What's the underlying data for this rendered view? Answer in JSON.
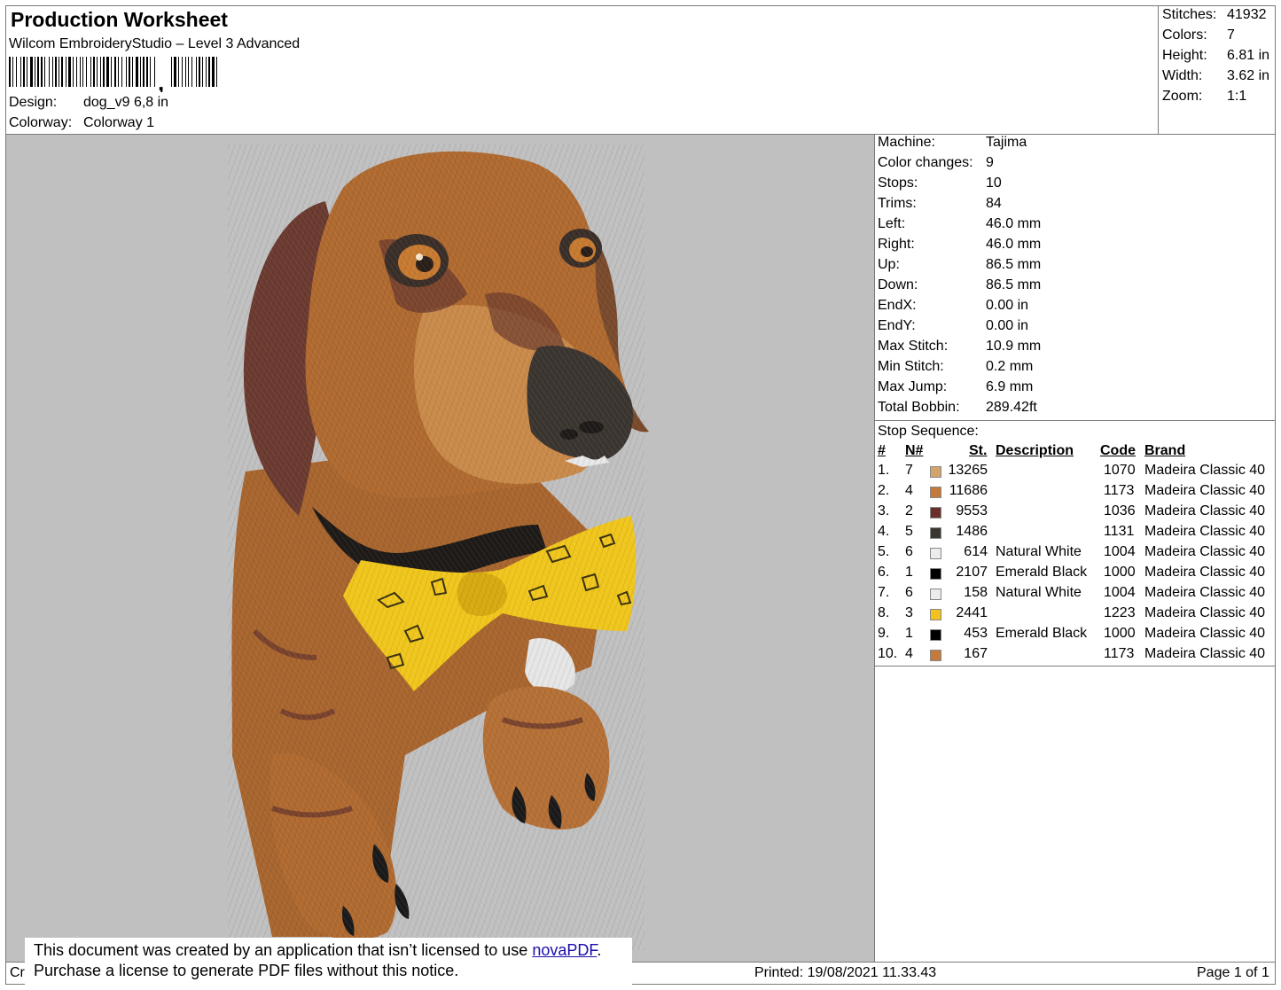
{
  "header": {
    "title": "Production Worksheet",
    "software": "Wilcom EmbroideryStudio – Level 3 Advanced",
    "design_label": "Design:",
    "design_value": "dog_v9 6,8 in",
    "colorway_label": "Colorway:",
    "colorway_value": "Colorway 1"
  },
  "stats": [
    {
      "label": "Stitches:",
      "value": "41932"
    },
    {
      "label": "Colors:",
      "value": "7"
    },
    {
      "label": "Height:",
      "value": "6.81 in"
    },
    {
      "label": "Width:",
      "value": "3.62 in"
    },
    {
      "label": "Zoom:",
      "value": "1:1"
    }
  ],
  "machine_info": [
    {
      "label": "Machine:",
      "value": "Tajima"
    },
    {
      "label": "Color changes:",
      "value": "9"
    },
    {
      "label": "Stops:",
      "value": "10"
    },
    {
      "label": "Trims:",
      "value": "84"
    },
    {
      "label": "Left:",
      "value": "46.0 mm"
    },
    {
      "label": "Right:",
      "value": "46.0 mm"
    },
    {
      "label": "Up:",
      "value": "86.5 mm"
    },
    {
      "label": "Down:",
      "value": "86.5 mm"
    },
    {
      "label": "EndX:",
      "value": "0.00 in"
    },
    {
      "label": "EndY:",
      "value": "0.00 in"
    },
    {
      "label": "Max Stitch:",
      "value": "10.9 mm"
    },
    {
      "label": "Min Stitch:",
      "value": "0.2 mm"
    },
    {
      "label": "Max Jump:",
      "value": "6.9 mm"
    },
    {
      "label": "Total Bobbin:",
      "value": "289.42ft"
    }
  ],
  "stop_sequence": {
    "title": "Stop Sequence:",
    "headers": {
      "num": "#",
      "n": "N#",
      "st": "St.",
      "desc": "Description",
      "code": "Code",
      "brand": "Brand"
    },
    "rows": [
      {
        "num": "1.",
        "n": "7",
        "color": "#d2a36b",
        "st": "13265",
        "desc": "",
        "code": "1070",
        "brand": "Madeira Classic 40"
      },
      {
        "num": "2.",
        "n": "4",
        "color": "#c47a3a",
        "st": "11686",
        "desc": "",
        "code": "1173",
        "brand": "Madeira Classic 40"
      },
      {
        "num": "3.",
        "n": "2",
        "color": "#6b2e2a",
        "st": "9553",
        "desc": "",
        "code": "1036",
        "brand": "Madeira Classic 40"
      },
      {
        "num": "4.",
        "n": "5",
        "color": "#3a3632",
        "st": "1486",
        "desc": "",
        "code": "1131",
        "brand": "Madeira Classic 40"
      },
      {
        "num": "5.",
        "n": "6",
        "color": "#ececec",
        "st": "614",
        "desc": "Natural White",
        "code": "1004",
        "brand": "Madeira Classic 40"
      },
      {
        "num": "6.",
        "n": "1",
        "color": "#000000",
        "st": "2107",
        "desc": "Emerald Black",
        "code": "1000",
        "brand": "Madeira Classic 40"
      },
      {
        "num": "7.",
        "n": "6",
        "color": "#ececec",
        "st": "158",
        "desc": "Natural White",
        "code": "1004",
        "brand": "Madeira Classic 40"
      },
      {
        "num": "8.",
        "n": "3",
        "color": "#f2c31f",
        "st": "2441",
        "desc": "",
        "code": "1223",
        "brand": "Madeira Classic 40"
      },
      {
        "num": "9.",
        "n": "1",
        "color": "#000000",
        "st": "453",
        "desc": "Emerald Black",
        "code": "1000",
        "brand": "Madeira Classic 40"
      },
      {
        "num": "10.",
        "n": "4",
        "color": "#c47a3a",
        "st": "167",
        "desc": "",
        "code": "1173",
        "brand": "Madeira Classic 40"
      }
    ]
  },
  "footer": {
    "left_stub": "Cr",
    "printed": "Printed: 19/08/2021 11.33.43",
    "page": "Page 1 of 1"
  },
  "notice": {
    "line1_prefix": "This document was created by an application that isn’t licensed to use ",
    "link": "novaPDF",
    "line1_suffix": ".",
    "line2": "Purchase a license to generate PDF files without this notice."
  },
  "preview_background": "#c0c0c0"
}
